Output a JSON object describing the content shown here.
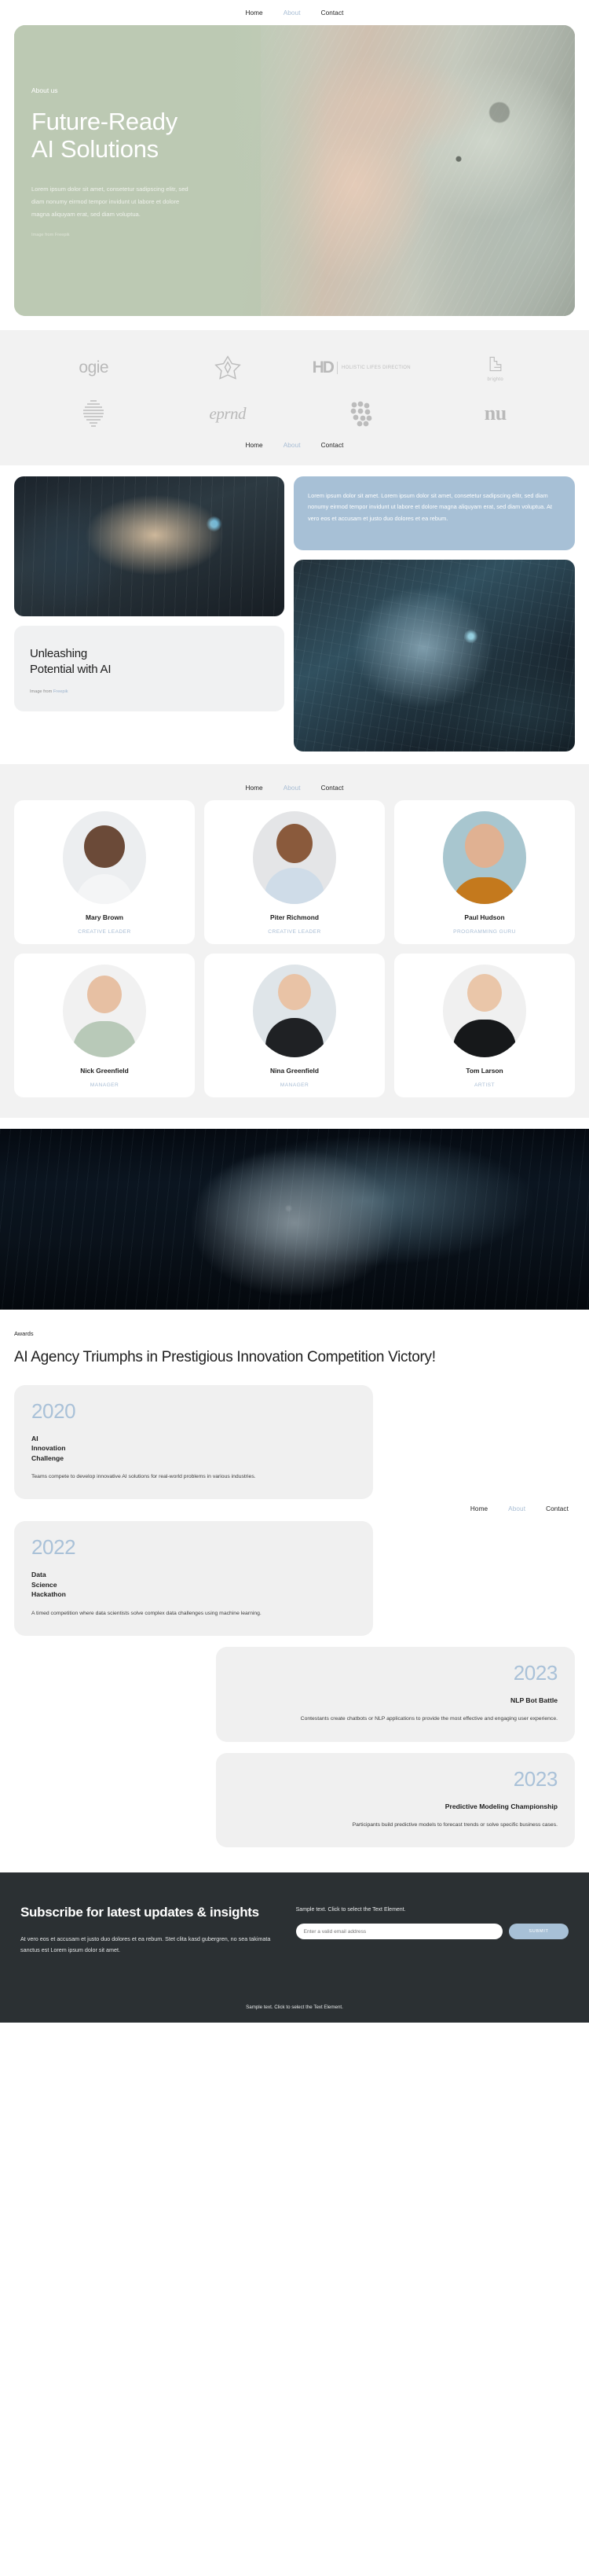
{
  "nav": {
    "items": [
      {
        "label": "Home",
        "state": "active"
      },
      {
        "label": "About",
        "state": "muted"
      },
      {
        "label": "Contact",
        "state": "normal"
      }
    ]
  },
  "hero": {
    "eyebrow": "About us",
    "title_line1": "Future-Ready",
    "title_line2": "AI Solutions",
    "paragraph": "Lorem ipsum dolor sit amet, consetetur sadipscing elitr, sed diam nonumy eirmod tempor invidunt ut labore et dolore magna aliquyam erat, sed diam voluptua.",
    "credit": "Image from Freepik"
  },
  "logos": [
    {
      "name": "ogie",
      "type": "wordmark"
    },
    {
      "name": "flower-star-icon",
      "type": "mark"
    },
    {
      "name": "HD",
      "sub": "HOLISTIC LIFES DIRECTION",
      "type": "hd"
    },
    {
      "name": "brighto",
      "type": "brighto"
    },
    {
      "name": "striped-sphere-icon",
      "type": "mark"
    },
    {
      "name": "eprnd",
      "type": "wordmark"
    },
    {
      "name": "dots-cluster-icon",
      "type": "mark"
    },
    {
      "name": "nu",
      "type": "wordmark"
    }
  ],
  "showcase": {
    "blue_card_text": "Lorem ipsum dolor sit amet. Lorem ipsum dolor sit amet, consetetur sadipscing elitr, sed diam nonumy eirmod tempor invidunt ut labore et dolore magna aliquyam erat, sed diam voluptua. At vero eos et accusam et justo duo dolores et ea rebum.",
    "card_title_line1": "Unleashing",
    "card_title_line2": "Potential with AI",
    "card_credit_prefix": "Image from ",
    "card_credit_link": "Freepik"
  },
  "team": [
    {
      "name": "Mary Brown",
      "role": "CREATIVE LEADER"
    },
    {
      "name": "Piter Richmond",
      "role": "CREATIVE LEADER"
    },
    {
      "name": "Paul Hudson",
      "role": "PROGRAMMING GURU"
    },
    {
      "name": "Nick Greenfield",
      "role": "MANAGER"
    },
    {
      "name": "Nina Greenfield",
      "role": "MANAGER"
    },
    {
      "name": "Tom Larson",
      "role": "ARTIST"
    }
  ],
  "awards": {
    "eyebrow": "Awards",
    "title": "AI Agency Triumphs in Prestigious Innovation Competition Victory!",
    "items": [
      {
        "year": "2020",
        "name": "AI\nInnovation\nChallenge",
        "desc": "Teams compete to develop innovative AI solutions for real-world problems in various industries.",
        "align": "left"
      },
      {
        "year": "2022",
        "name": "Data\nScience\nHackathon",
        "desc": "A timed competition where data scientists solve complex data challenges using machine learning.",
        "align": "left"
      },
      {
        "year": "2023",
        "name": "NLP Bot Battle",
        "desc": "Contestants create chatbots or NLP applications to provide the most effective and engaging user experience.",
        "align": "right"
      },
      {
        "year": "2023",
        "name": "Predictive Modeling Championship",
        "desc": "Participants build predictive models to forecast trends or solve specific business cases.",
        "align": "right"
      }
    ]
  },
  "footer": {
    "title": "Subscribe for latest updates & insights",
    "paragraph": "At vero eos et accusam et justo duo dolores et ea rebum. Stet clita kasd gubergren, no sea takimata sanctus est Lorem ipsum dolor sit amet.",
    "sample_text": "Sample text. Click to select the Text Element.",
    "email_placeholder": "Enter a valid email address",
    "submit_label": "SUBMIT",
    "bottom_text": "Sample text. Click to select the Text Element."
  },
  "colors": {
    "hero_green": "#bcc9b3",
    "accent_blue": "#a7c0d6",
    "footer_dark": "#2b3033",
    "light_gray": "#f2f2f2"
  }
}
